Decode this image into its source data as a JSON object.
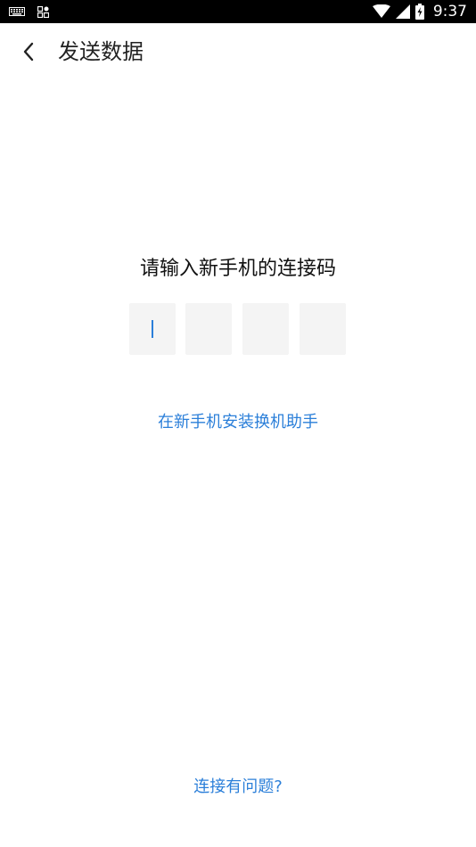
{
  "status_bar": {
    "time": "9:37",
    "icons": [
      "keyboard-icon",
      "qr-icon",
      "wifi-icon",
      "signal-icon",
      "battery-charging-icon"
    ]
  },
  "app_bar": {
    "title": "发送数据",
    "back_icon": "chevron-left-icon"
  },
  "main": {
    "prompt": "请输入新手机的连接码",
    "code_slots": 4,
    "accent_color": "#2b7fd9",
    "install_link": "在新手机安装换机助手"
  },
  "footer": {
    "help_link": "连接有问题?"
  }
}
